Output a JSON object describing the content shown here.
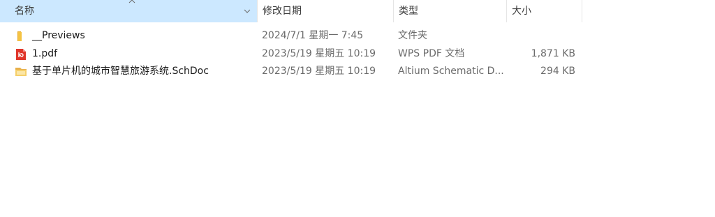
{
  "header": {
    "name": "名称",
    "date": "修改日期",
    "type": "类型",
    "size": "大小"
  },
  "colors": {
    "selected_header": "#cce8ff",
    "folder": "#f5c342",
    "pdf_red": "#e0362b"
  },
  "files": [
    {
      "icon": "folder-icon",
      "name": "__Previews",
      "date": "2024/7/1 星期一 7:45",
      "type": "文件夹",
      "size": ""
    },
    {
      "icon": "pdf-file-icon",
      "name": "1.pdf",
      "date": "2023/5/19 星期五 10:19",
      "type": "WPS PDF 文档",
      "size": "1,871 KB"
    },
    {
      "icon": "schdoc-file-icon",
      "name": "基于单片机的城市智慧旅游系统.SchDoc",
      "date": "2023/5/19 星期五 10:19",
      "type": "Altium Schematic D...",
      "size": "294 KB"
    }
  ]
}
